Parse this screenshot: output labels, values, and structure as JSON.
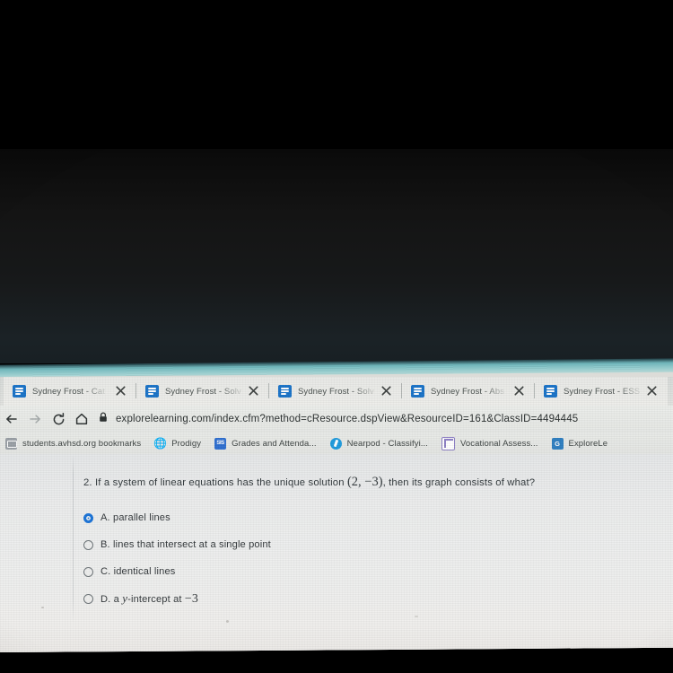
{
  "browser": {
    "tabs": [
      {
        "title": "Sydney Frost - Cat",
        "favicon": "document-icon",
        "close": "close-icon"
      },
      {
        "title": "Sydney Frost - Solv",
        "favicon": "document-icon",
        "close": "close-icon"
      },
      {
        "title": "Sydney Frost - Solv",
        "favicon": "document-icon",
        "close": "close-icon"
      },
      {
        "title": "Sydney Frost - Abs",
        "favicon": "document-icon",
        "close": "close-icon"
      },
      {
        "title": "Sydney Frost - ESS",
        "favicon": "document-icon",
        "close": "close-icon"
      }
    ],
    "nav": {
      "back": "back-arrow-icon",
      "forward": "forward-arrow-icon",
      "reload": "reload-icon",
      "home": "home-icon"
    },
    "omnibox": {
      "lock": "lock-icon",
      "url": "explorelearning.com/index.cfm?method=cResource.dspView&ResourceID=161&ClassID=4494445"
    },
    "bookmarks": [
      {
        "label": "students.avhsd.org bookmarks",
        "icon": "folder-icon"
      },
      {
        "label": "Prodigy",
        "icon": "globe-icon"
      },
      {
        "label": "Grades and Attenda...",
        "icon": "sis-icon"
      },
      {
        "label": "Nearpod - Classifyi...",
        "icon": "nearpod-icon"
      },
      {
        "label": "Vocational Assess...",
        "icon": "grid-icon"
      },
      {
        "label": "ExploreLe",
        "icon": "explorelearning-icon"
      }
    ]
  },
  "question": {
    "number": "2.",
    "prefix": "2. If a system of linear equations has the unique solution ",
    "solution": "(2, −3)",
    "suffix": ", then its graph consists of what?",
    "options": [
      {
        "letter": "A.",
        "text": "A. parallel lines",
        "selected": true
      },
      {
        "letter": "B.",
        "text": "B. lines that intersect at a single point",
        "selected": false
      },
      {
        "letter": "C.",
        "text": "C. identical lines",
        "selected": false
      },
      {
        "letter": "D.",
        "text_pre": "D. a ",
        "variable": "y",
        "text_post": "-intercept at ",
        "value": "−3",
        "selected": false
      }
    ]
  },
  "colors": {
    "accent_blue": "#1a73d8",
    "tab_favicon_blue": "#1a73c8",
    "page_background": "#eceded",
    "text": "#34393c",
    "dark_surround": "#000000",
    "glow_teal": "#9ed3d4"
  }
}
